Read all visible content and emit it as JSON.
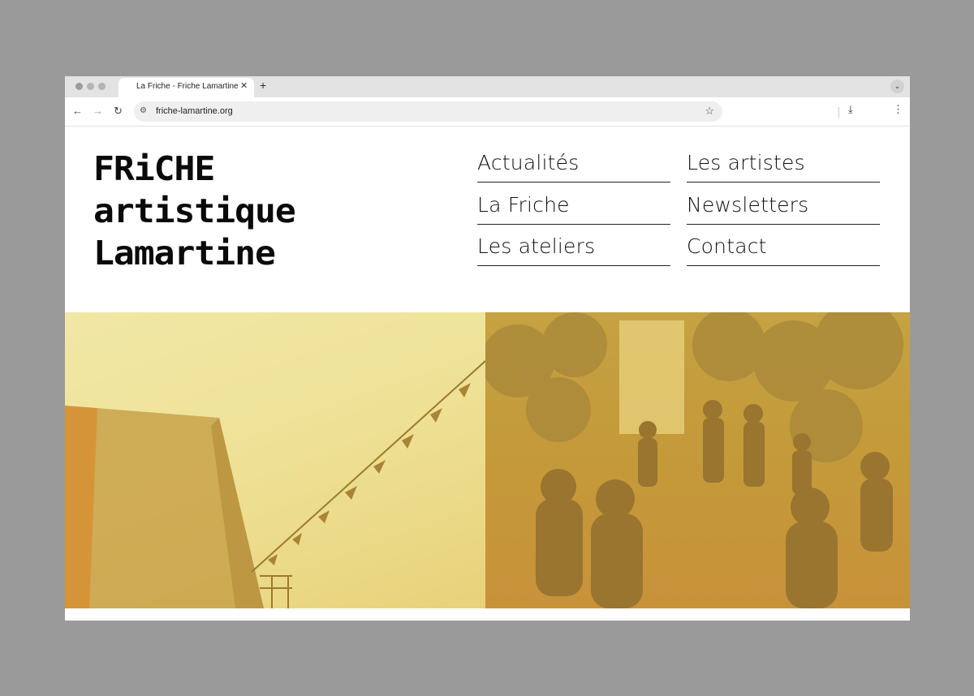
{
  "browser": {
    "tab_title": "La Friche - Friche Lamartine",
    "tab_close": "✕",
    "new_tab": "+",
    "url": "friche-lamartine.org",
    "icons": [
      "back-arrow-icon",
      "forward-arrow-icon",
      "reload-icon",
      "site-settings-icon",
      "bookmark-star-icon",
      "download-icon",
      "menu-kebab-icon",
      "tab-search-icon"
    ]
  },
  "site": {
    "logo_lines": [
      "FRiCHE",
      "artistique",
      "Lamartine"
    ],
    "nav": [
      {
        "label": "Actualités"
      },
      {
        "label": "Les artistes"
      },
      {
        "label": "La Friche"
      },
      {
        "label": "Newsletters"
      },
      {
        "label": "Les ateliers"
      },
      {
        "label": "Contact"
      }
    ]
  },
  "colors": {
    "photo_tint": "#e3c45a",
    "text": "#111111"
  }
}
